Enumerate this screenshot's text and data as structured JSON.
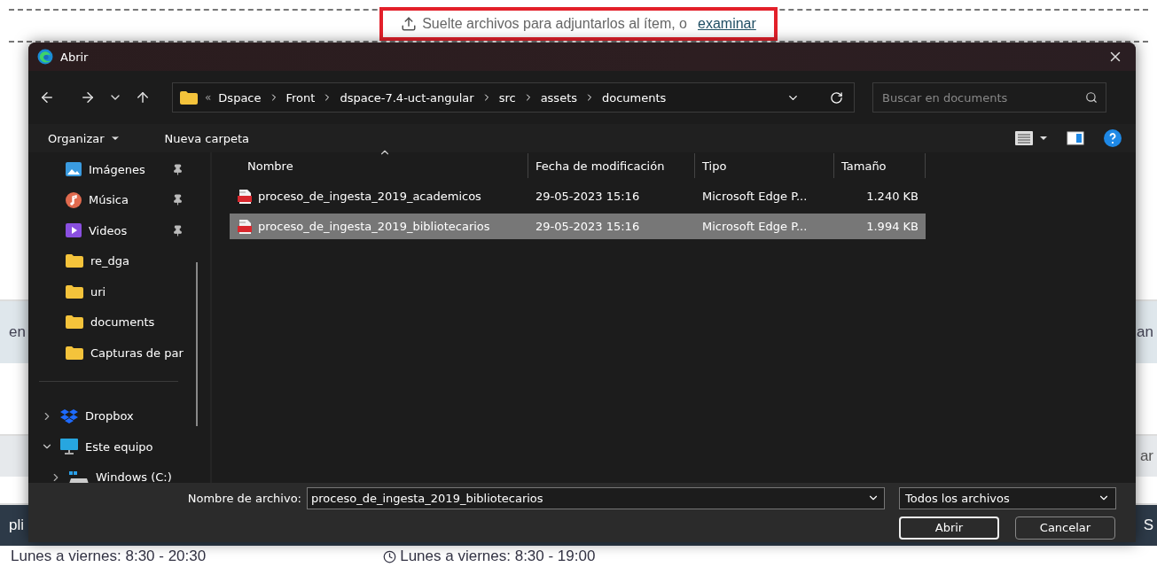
{
  "page": {
    "dropzone": {
      "text": "Suelte archivos para adjuntarlos al ítem, o",
      "link": "examinar",
      "highlighted": true
    },
    "left_fragments": [
      "en",
      "pli"
    ],
    "right_fragments": [
      "an",
      "ar",
      "S"
    ],
    "hours": [
      "Lunes a viernes: 8:30 - 20:30",
      "Lunes a viernes: 8:30 - 19:00"
    ]
  },
  "dialog": {
    "title": "Abrir",
    "path_overflow": "«",
    "path": [
      "Dspace",
      "Front",
      "dspace-7.4-uct-angular",
      "src",
      "assets",
      "documents"
    ],
    "search": {
      "placeholder": "Buscar en documents"
    },
    "toolbar": [
      {
        "label": "Organizar",
        "menu": true
      },
      {
        "label": "Nueva carpeta",
        "menu": false
      }
    ],
    "sidebar": [
      {
        "label": "Imágenes",
        "kind": "pictures",
        "pinned": true
      },
      {
        "label": "Música",
        "kind": "music",
        "pinned": true
      },
      {
        "label": "Videos",
        "kind": "videos",
        "pinned": true
      },
      {
        "label": "re_dga",
        "kind": "folder",
        "pinned": false
      },
      {
        "label": "uri",
        "kind": "folder",
        "pinned": false
      },
      {
        "label": "documents",
        "kind": "folder",
        "pinned": false
      },
      {
        "label": "Capturas de par",
        "kind": "folder",
        "pinned": false
      },
      {
        "kind": "divider"
      },
      {
        "label": "Dropbox",
        "kind": "dropbox",
        "pinned": false,
        "expanded": false
      },
      {
        "label": "Este equipo",
        "kind": "computer",
        "pinned": false,
        "expanded": true,
        "children": [
          {
            "label": "Windows (C:)",
            "kind": "drive",
            "pinned": false,
            "expanded": false
          }
        ]
      }
    ],
    "columns": [
      "Nombre",
      "Fecha de modificación",
      "Tipo",
      "Tamaño"
    ],
    "files": [
      {
        "name": "proceso_de_ingesta_2019_academicos",
        "date": "29-05-2023 15:16",
        "type": "Microsoft Edge P...",
        "size": "1.240 KB",
        "selected": false
      },
      {
        "name": "proceso_de_ingesta_2019_bibliotecarios",
        "date": "29-05-2023 15:16",
        "type": "Microsoft Edge P...",
        "size": "1.994 KB",
        "selected": true
      }
    ],
    "filename_label": "Nombre de archivo:",
    "filename": "proceso_de_ingesta_2019_bibliotecarios",
    "filter": "Todos los archivos",
    "buttons": [
      {
        "label": "Abrir",
        "default": true
      },
      {
        "label": "Cancelar",
        "default": false
      }
    ]
  }
}
